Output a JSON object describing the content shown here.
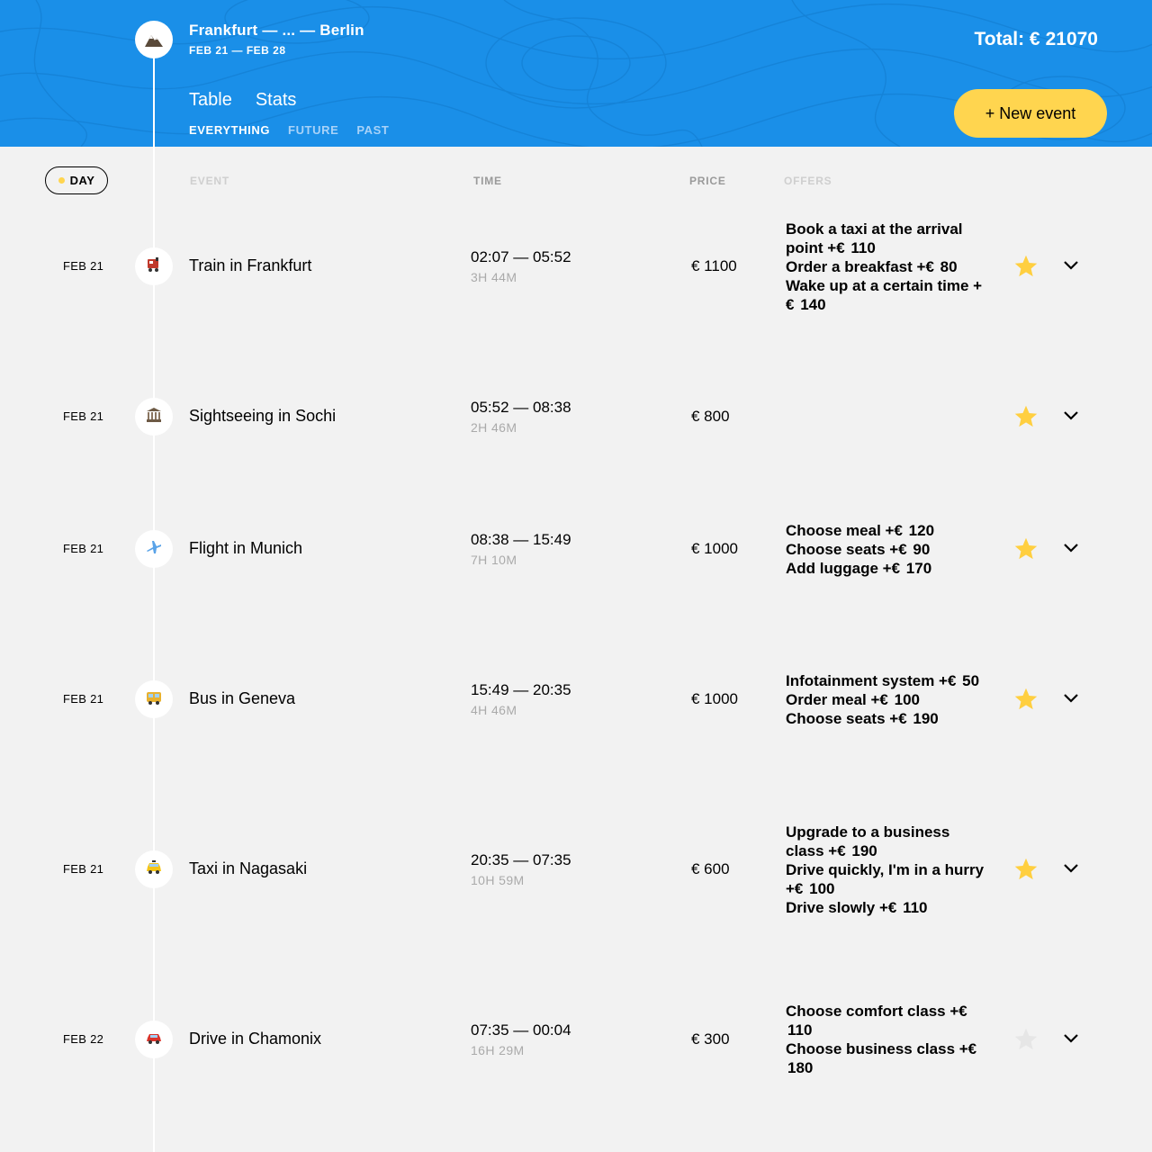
{
  "header": {
    "trip_title": "Frankfurt — ... — Berlin",
    "trip_dates": "FEB 21 — FEB 28",
    "total_label": "Total: €",
    "total_value": "21070",
    "tabs": [
      {
        "label": "Table",
        "active": true
      },
      {
        "label": "Stats",
        "active": false
      }
    ],
    "filters": [
      {
        "label": "EVERYTHING",
        "active": true
      },
      {
        "label": "FUTURE",
        "active": false
      },
      {
        "label": "PAST",
        "active": false
      }
    ],
    "new_event_label": "+ New event",
    "colors": {
      "background": "#1a8fe8",
      "accent": "#ffd54f"
    }
  },
  "sort": {
    "day_label": "DAY",
    "event_label": "EVENT",
    "time_label": "TIME",
    "price_label": "PRICE",
    "offers_label": "OFFERS"
  },
  "events": [
    {
      "date": "FEB 21",
      "icon": "train-icon",
      "title": "Train in Frankfurt",
      "time": "02:07 — 05:52",
      "duration": "3H 44M",
      "price": "€ 1100",
      "favorite": true,
      "offers": [
        {
          "title": "Book a taxi at the arrival point",
          "price": "110"
        },
        {
          "title": "Order a breakfast",
          "price": "80"
        },
        {
          "title": "Wake up at a certain time",
          "price": "140"
        }
      ]
    },
    {
      "date": "FEB 21",
      "icon": "sightseeing-icon",
      "title": "Sightseeing in Sochi",
      "time": "05:52 — 08:38",
      "duration": "2H 46M",
      "price": "€ 800",
      "favorite": true,
      "offers": []
    },
    {
      "date": "FEB 21",
      "icon": "flight-icon",
      "title": "Flight in Munich",
      "time": "08:38 — 15:49",
      "duration": "7H 10M",
      "price": "€ 1000",
      "favorite": true,
      "offers": [
        {
          "title": "Choose meal",
          "price": "120"
        },
        {
          "title": "Choose seats",
          "price": "90"
        },
        {
          "title": "Add luggage",
          "price": "170"
        }
      ]
    },
    {
      "date": "FEB 21",
      "icon": "bus-icon",
      "title": "Bus in Geneva",
      "time": "15:49 — 20:35",
      "duration": "4H 46M",
      "price": "€ 1000",
      "favorite": true,
      "offers": [
        {
          "title": "Infotainment system",
          "price": "50"
        },
        {
          "title": "Order meal",
          "price": "100"
        },
        {
          "title": "Choose seats",
          "price": "190"
        }
      ]
    },
    {
      "date": "FEB 21",
      "icon": "taxi-icon",
      "title": "Taxi in Nagasaki",
      "time": "20:35 — 07:35",
      "duration": "10H 59M",
      "price": "€ 600",
      "favorite": true,
      "offers": [
        {
          "title": "Upgrade to a business class",
          "price": "190"
        },
        {
          "title": "Drive quickly, I'm in a hurry",
          "price": "100"
        },
        {
          "title": "Drive slowly",
          "price": "110"
        }
      ]
    },
    {
      "date": "FEB 22",
      "icon": "drive-icon",
      "title": "Drive in Chamonix",
      "time": "07:35 — 00:04",
      "duration": "16H 29M",
      "price": "€ 300",
      "favorite": false,
      "offers": [
        {
          "title": "Choose comfort class",
          "price": "110"
        },
        {
          "title": "Choose business class",
          "price": "180"
        }
      ]
    }
  ]
}
